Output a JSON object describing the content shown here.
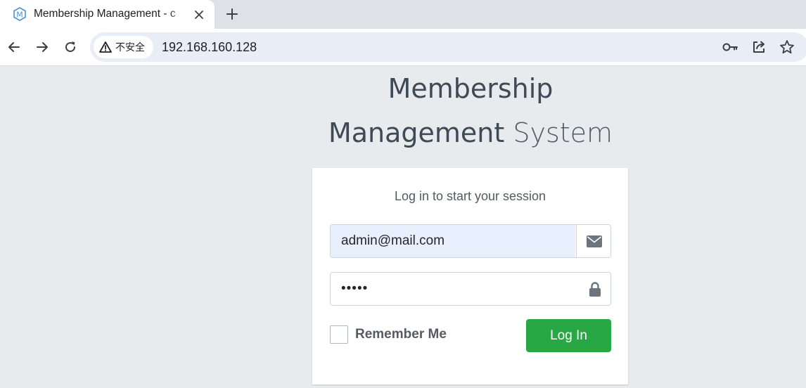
{
  "browser": {
    "tab": {
      "title": "Membership Management - c",
      "favicon": "m-logo-icon"
    },
    "address_bar": {
      "security_label": "不安全",
      "url": "192.168.160.128"
    },
    "icons": {
      "back": "back-arrow-icon",
      "forward": "forward-arrow-icon",
      "reload": "reload-icon",
      "key": "key-icon",
      "share": "share-icon",
      "bookmark": "star-icon"
    }
  },
  "page": {
    "logo": {
      "line1": "Membership",
      "line2_bold": "Management",
      "line2_light": "System"
    },
    "login": {
      "message": "Log in to start your session",
      "email_value": "admin@mail.com",
      "password_value": "•••••",
      "remember_label": "Remember Me",
      "remember_checked": false,
      "button_label": "Log In"
    }
  },
  "colors": {
    "primary_button": "#28a745",
    "background": "#e8ebee",
    "autofill": "#e8f0fe"
  }
}
